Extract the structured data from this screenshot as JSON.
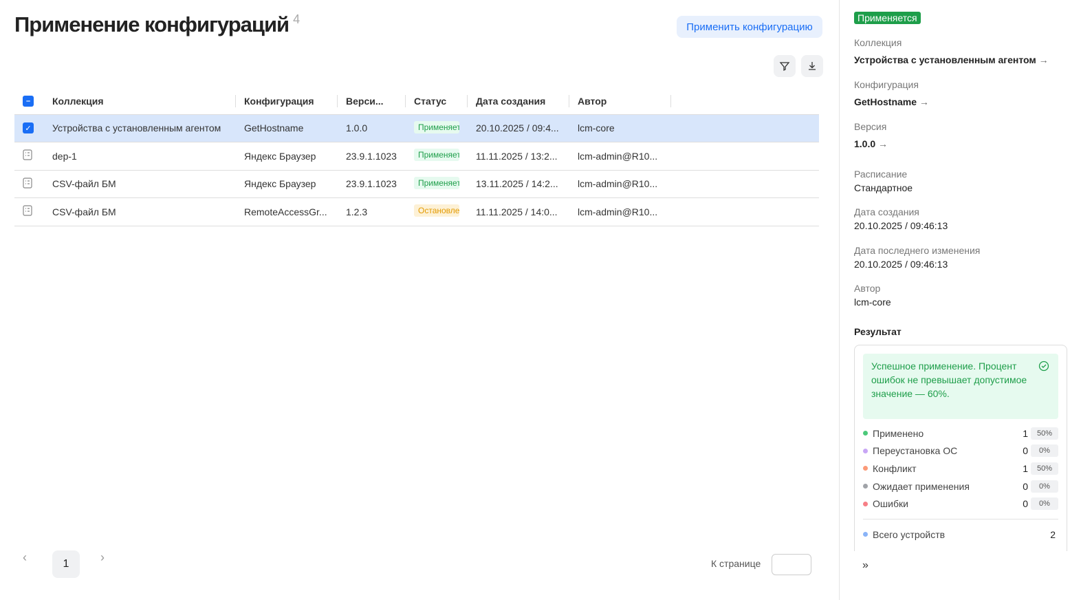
{
  "header": {
    "title": "Применение конфигураций",
    "count": "4",
    "apply_label": "Применить конфигурацию"
  },
  "table": {
    "columns": [
      "Коллекция",
      "Конфигурация",
      "Верси...",
      "Статус",
      "Дата создания",
      "Автор"
    ],
    "rows": [
      {
        "collection": "Устройства с установленным агентом",
        "config": "GetHostname",
        "version": "1.0.0",
        "status": "Применяется",
        "date": "20.10.2025 / 09:4...",
        "author": "lcm-core",
        "selected": true
      },
      {
        "collection": "dep-1",
        "config": "Яндекс Браузер",
        "version": "23.9.1.1023",
        "status": "Применяется",
        "date": "11.11.2025 / 13:2...",
        "author": "lcm-admin@R10..."
      },
      {
        "collection": "CSV-файл БМ",
        "config": "Яндекс Браузер",
        "version": "23.9.1.1023",
        "status": "Применяется",
        "date": "13.11.2025 / 14:2...",
        "author": "lcm-admin@R10..."
      },
      {
        "collection": "CSV-файл БМ",
        "config": "RemoteAccessGr...",
        "version": "1.2.3",
        "status": "Остановлено",
        "date": "11.11.2025 / 14:0...",
        "author": "lcm-admin@R10..."
      }
    ]
  },
  "pagination": {
    "page": "1",
    "goto_label": "К странице",
    "goto_value": ""
  },
  "panel": {
    "status": "Применяется",
    "collection_label": "Коллекция",
    "collection": "Устройства с установленным агентом",
    "config_label": "Конфигурация",
    "config": "GetHostname",
    "version_label": "Версия",
    "version": "1.0.0",
    "schedule_label": "Расписание",
    "schedule": "Стандартное",
    "created_label": "Дата создания",
    "created": "20.10.2025 / 09:46:13",
    "modified_label": "Дата последнего изменения",
    "modified": "20.10.2025 / 09:46:13",
    "author_label": "Автор",
    "author": "lcm-core",
    "result_label": "Результат",
    "result_message": "Успешное применение. Процент ошибок не превышает допустимое значение — 60%.",
    "stats": [
      {
        "label": "Применено",
        "count": "1",
        "pct": "50%",
        "color": "#4cc97a"
      },
      {
        "label": "Переустановка ОС",
        "count": "0",
        "pct": "0%",
        "color": "#c8a6f5"
      },
      {
        "label": "Конфликт",
        "count": "1",
        "pct": "50%",
        "color": "#fb9a78"
      },
      {
        "label": "Ожидает применения",
        "count": "0",
        "pct": "0%",
        "color": "#a0a3a8"
      },
      {
        "label": "Ошибки",
        "count": "0",
        "pct": "0%",
        "color": "#f77f86"
      }
    ],
    "total_label": "Всего устройств",
    "total": "2",
    "total_color": "#8ab4f8"
  }
}
